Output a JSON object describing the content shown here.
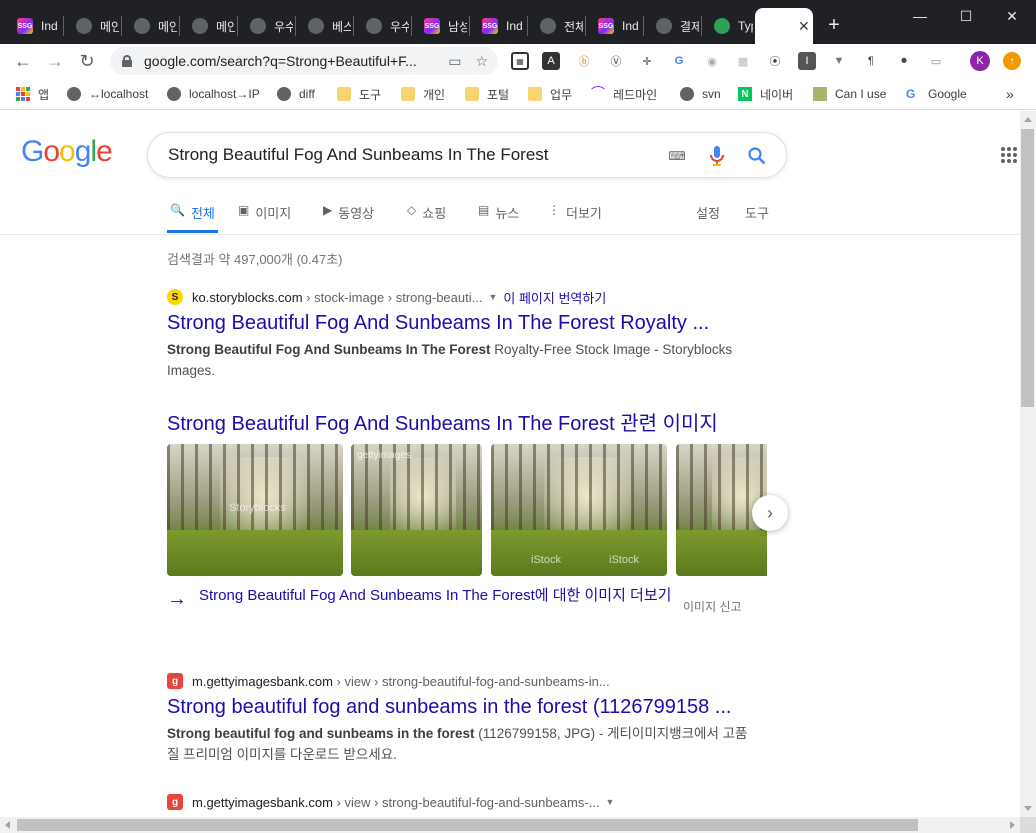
{
  "browser": {
    "tabs": [
      {
        "label": "Ind",
        "icon": "ssg"
      },
      {
        "label": "메인",
        "icon": "globe"
      },
      {
        "label": "메인",
        "icon": "globe"
      },
      {
        "label": "메인",
        "icon": "globe"
      },
      {
        "label": "우수",
        "icon": "globe"
      },
      {
        "label": "베스",
        "icon": "globe"
      },
      {
        "label": "우수",
        "icon": "globe"
      },
      {
        "label": "남성",
        "icon": "ssg"
      },
      {
        "label": "Ind",
        "icon": "ssg"
      },
      {
        "label": "전체",
        "icon": "globe"
      },
      {
        "label": "Ind",
        "icon": "ssg"
      },
      {
        "label": "결제",
        "icon": "globe"
      },
      {
        "label": "Typ",
        "icon": "typo"
      },
      {
        "label": "G",
        "icon": "google",
        "active": true
      }
    ],
    "url": "google.com/search?q=Strong+Beautiful+F...",
    "avatar_letter": "K",
    "bookmarks": [
      {
        "label": "앱",
        "icon": "apps"
      },
      {
        "label": "↔localhost",
        "icon": "globe"
      },
      {
        "label": "localhost→IP",
        "icon": "globe"
      },
      {
        "label": "diff",
        "icon": "globe"
      },
      {
        "label": "도구",
        "icon": "folder"
      },
      {
        "label": "개인",
        "icon": "folder"
      },
      {
        "label": "포털",
        "icon": "folder"
      },
      {
        "label": "업무",
        "icon": "folder"
      },
      {
        "label": "레드마인",
        "icon": "redmine"
      },
      {
        "label": "svn",
        "icon": "globe"
      },
      {
        "label": "네이버",
        "icon": "naver"
      },
      {
        "label": "Can I use",
        "icon": "caniuse"
      },
      {
        "label": "Google",
        "icon": "google"
      }
    ],
    "bookmarks_overflow": "»"
  },
  "google": {
    "query": "Strong Beautiful Fog And Sunbeams In The Forest",
    "tabs": [
      {
        "label": "전체",
        "icon": "🔍",
        "active": true
      },
      {
        "label": "이미지",
        "icon": "▣"
      },
      {
        "label": "동영상",
        "icon": "▶"
      },
      {
        "label": "쇼핑",
        "icon": "◇"
      },
      {
        "label": "뉴스",
        "icon": "▤"
      },
      {
        "label": "더보기",
        "icon": "⋮"
      }
    ],
    "settings_label": "설정",
    "tools_label": "도구",
    "stats": "검색결과 약 497,000개 (0.47초)",
    "results": [
      {
        "site": "ko.storyblocks.com",
        "path": "› stock-image › strong-beauti...",
        "translate": "이 페이지 번역하기",
        "title": "Strong Beautiful Fog And Sunbeams In The Forest Royalty ...",
        "snippet_bold": "Strong Beautiful Fog And Sunbeams In The Forest",
        "snippet_rest": " Royalty-Free Stock Image - Storyblocks Images."
      },
      {
        "site": "m.gettyimagesbank.com",
        "path": "› view › strong-beautiful-fog-and-sunbeams-in...",
        "title": "Strong beautiful fog and sunbeams in the forest (1126799158 ...",
        "snippet_bold": "Strong beautiful fog and sunbeams in the forest",
        "snippet_rest": " (1126799158, JPG) - 게티이미지뱅크에서 고품질 프리미엄 이미지를 다운로드 받으세요."
      },
      {
        "site": "m.gettyimagesbank.com",
        "path": "› view › strong-beautiful-fog-and-sunbeams-..."
      }
    ],
    "images_heading": "Strong Beautiful Fog And Sunbeams In The Forest 관련 이미지",
    "more_images": "Strong Beautiful Fog And Sunbeams In The Forest에 대한 이미지 더보기",
    "report_images": "이미지 신고",
    "watermarks": [
      "Storyblocks",
      "gettyimages",
      "iStock",
      "iStock"
    ]
  }
}
